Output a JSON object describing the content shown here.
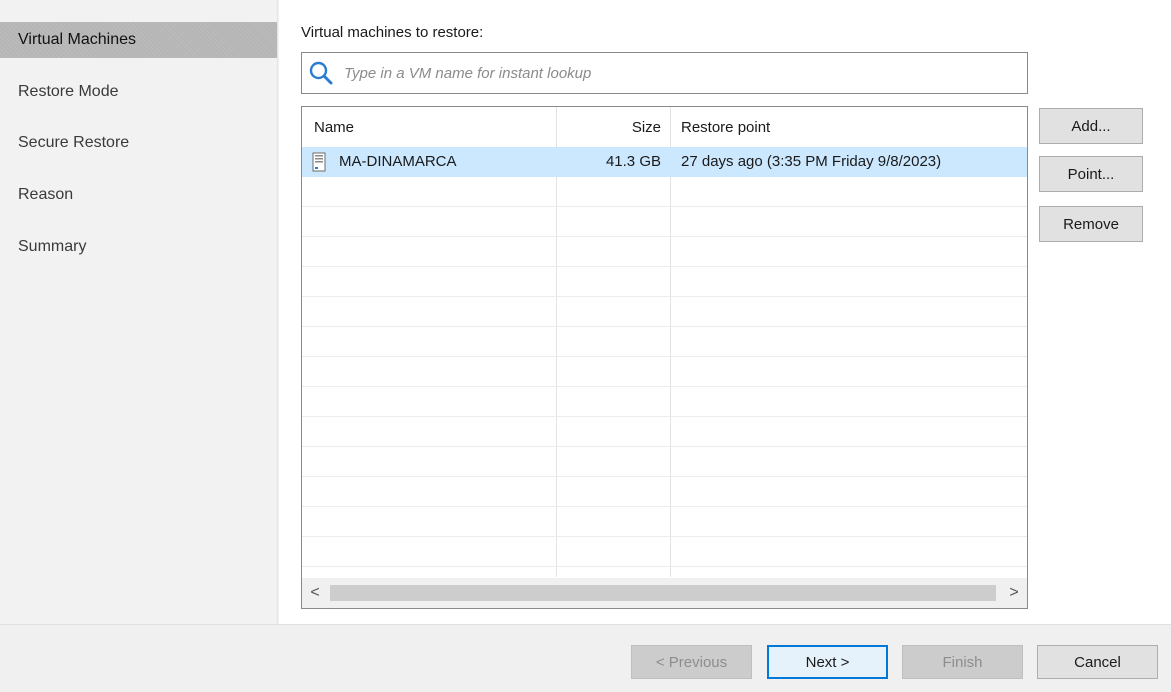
{
  "sidebar": {
    "items": [
      {
        "label": "Virtual Machines",
        "active": true
      },
      {
        "label": "Restore Mode"
      },
      {
        "label": "Secure Restore"
      },
      {
        "label": "Reason"
      },
      {
        "label": "Summary"
      }
    ]
  },
  "main": {
    "section_label": "Virtual machines to restore:",
    "search": {
      "placeholder": "Type in a VM name for instant lookup",
      "value": ""
    },
    "table": {
      "columns": {
        "name": "Name",
        "size": "Size",
        "restore_point": "Restore point"
      },
      "rows": [
        {
          "name": "MA-DINAMARCA",
          "size": "41.3 GB",
          "restore_point": "27 days ago (3:35 PM Friday 9/8/2023)"
        }
      ],
      "scroll_left": "<",
      "scroll_right": ">"
    },
    "buttons": {
      "add": "Add...",
      "point": "Point...",
      "remove": "Remove"
    }
  },
  "footer": {
    "previous": "< Previous",
    "next": "Next >",
    "finish": "Finish",
    "cancel": "Cancel"
  },
  "colors": {
    "selection": "#cce8ff",
    "accent": "#0078d7",
    "icon": "#2b7dd1"
  }
}
